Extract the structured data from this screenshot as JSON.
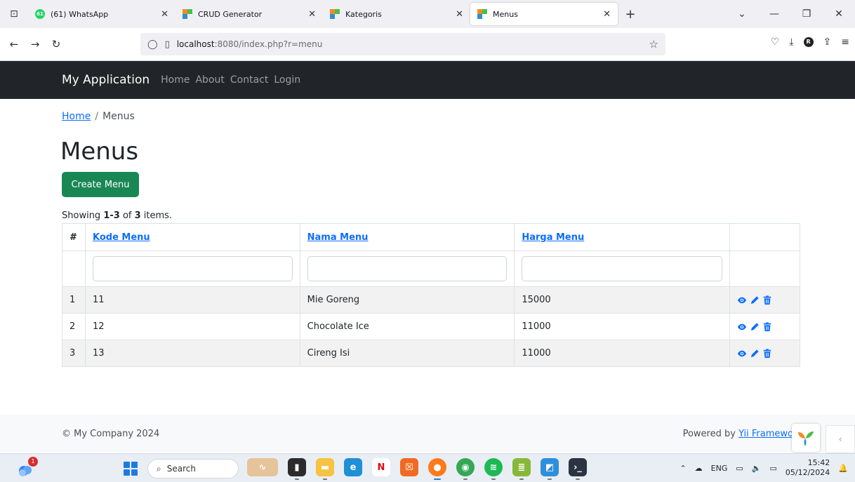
{
  "browser": {
    "tabs": [
      {
        "title": "(61) WhatsApp",
        "favicon": "whatsapp-icon",
        "active": false
      },
      {
        "title": "CRUD Generator",
        "favicon": "yii-icon",
        "active": false
      },
      {
        "title": "Kategoris",
        "favicon": "yii-icon",
        "active": false
      },
      {
        "title": "Menus",
        "favicon": "yii-icon",
        "active": true
      }
    ],
    "url_host": "localhost",
    "url_path": ":8080/index.php?r=menu",
    "profile_initial": "R",
    "whatsapp_badge": "61"
  },
  "navbar": {
    "brand": "My Application",
    "links": [
      "Home",
      "About",
      "Contact",
      "Login"
    ]
  },
  "breadcrumb": {
    "home": "Home",
    "separator": "/",
    "current": "Menus"
  },
  "page": {
    "title": "Menus",
    "create_button": "Create Menu",
    "summary_prefix": "Showing ",
    "summary_range": "1-3",
    "summary_mid": " of ",
    "summary_total": "3",
    "summary_suffix": " items."
  },
  "grid": {
    "columns": [
      "#",
      "Kode Menu",
      "Nama Menu",
      "Harga Menu"
    ],
    "rows": [
      {
        "num": "1",
        "kode": "11",
        "nama": "Mie Goreng",
        "harga": "15000"
      },
      {
        "num": "2",
        "kode": "12",
        "nama": "Chocolate Ice",
        "harga": "11000"
      },
      {
        "num": "3",
        "kode": "13",
        "nama": "Cireng Isi",
        "harga": "11000"
      }
    ]
  },
  "footer": {
    "copyright": "© My Company 2024",
    "powered_prefix": "Powered by ",
    "powered_link": "Yii Framewo"
  },
  "taskbar": {
    "search_placeholder": "Search",
    "notification_count": "1",
    "language": "ENG",
    "time": "15:42",
    "date": "05/12/2024"
  },
  "colors": {
    "navbar_bg": "#212529",
    "primary_link": "#0d6efd",
    "create_button": "#198754",
    "action_icon": "#0d6efd"
  }
}
